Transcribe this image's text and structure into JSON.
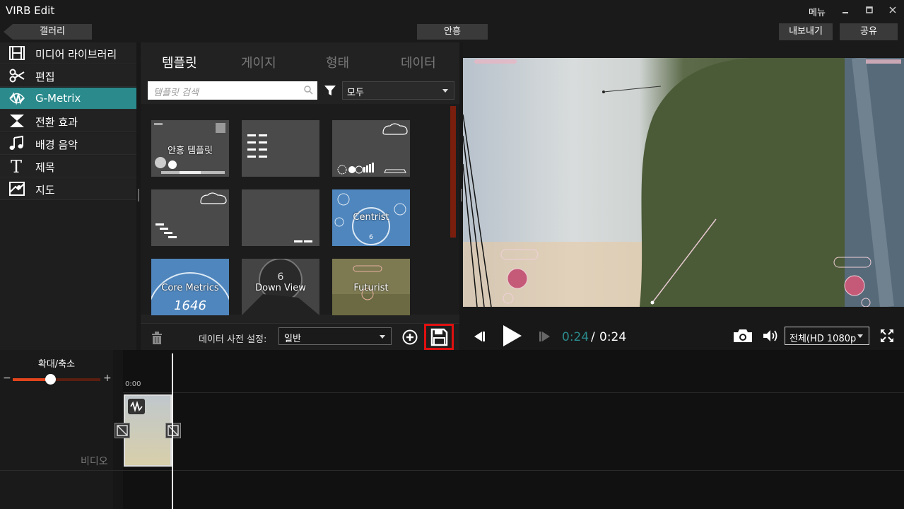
{
  "app": {
    "title": "VIRB Edit",
    "menu": "메뉴"
  },
  "topbar": {
    "gallery": "갤러리",
    "project": "안흥",
    "export": "내보내기",
    "share": "공유"
  },
  "sidebar": {
    "items": [
      {
        "label": "미디어 라이브러리",
        "icon": "film-icon"
      },
      {
        "label": "편집",
        "icon": "scissors-icon"
      },
      {
        "label": "G-Metrix",
        "icon": "gmetrix-icon",
        "active": true
      },
      {
        "label": "전환 효과",
        "icon": "transition-icon"
      },
      {
        "label": "배경 음악",
        "icon": "music-note-icon"
      },
      {
        "label": "제목",
        "icon": "title-t-icon"
      },
      {
        "label": "지도",
        "icon": "map-icon"
      }
    ]
  },
  "panel": {
    "tabs": [
      "템플릿",
      "게이지",
      "형태",
      "데이터"
    ],
    "search_placeholder": "템플릿 검색",
    "filter_value": "모두",
    "templates": [
      {
        "label": "안흥 템플릿"
      },
      {
        "label": ""
      },
      {
        "label": ""
      },
      {
        "label": ""
      },
      {
        "label": ""
      },
      {
        "label": "Centrist"
      },
      {
        "label": "Core Metrics"
      },
      {
        "label": "Down View"
      },
      {
        "label": "Futurist"
      }
    ],
    "preset_label": "데이터 사전 설정:",
    "preset_value": "일반"
  },
  "player": {
    "time_current": "0:24",
    "time_separator": "/",
    "time_total": "0:24",
    "quality": "전체(HD 1080p"
  },
  "timeline": {
    "zoom_label": "확대/축소",
    "zoom_minus": "−",
    "zoom_plus": "+",
    "zoom_level": 0.43,
    "ruler_start": "0:00",
    "video_track": "비디오"
  },
  "colors": {
    "accent": "#2a8a8c",
    "slider": "#e2451c",
    "highlight": "#e01010"
  }
}
